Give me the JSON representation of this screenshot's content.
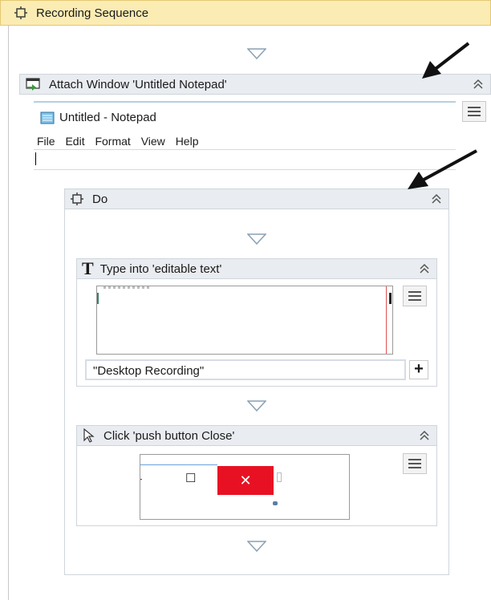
{
  "sequence": {
    "title": "Recording Sequence",
    "icon": "workflow-icon"
  },
  "attach_window": {
    "title": "Attach Window 'Untitled  Notepad'",
    "icon": "attach-window-icon",
    "preview": {
      "window_title": "Untitled - Notepad",
      "menu": [
        "File",
        "Edit",
        "Format",
        "View",
        "Help"
      ]
    }
  },
  "do_block": {
    "title": "Do",
    "icon": "workflow-icon"
  },
  "type_into": {
    "title": "Type into 'editable text'",
    "icon": "type-text-icon",
    "text_value": "\"Desktop Recording\"",
    "add_label": "+"
  },
  "click": {
    "title": "Click 'push button  Close'",
    "icon": "cursor-arrow-icon",
    "preview_symbols": {
      "maximize": "☐",
      "close": "✕"
    }
  },
  "colors": {
    "sequence_header_bg": "#fbecb3",
    "activity_header_bg": "#e9ecf0",
    "close_button_red": "#e81123"
  }
}
